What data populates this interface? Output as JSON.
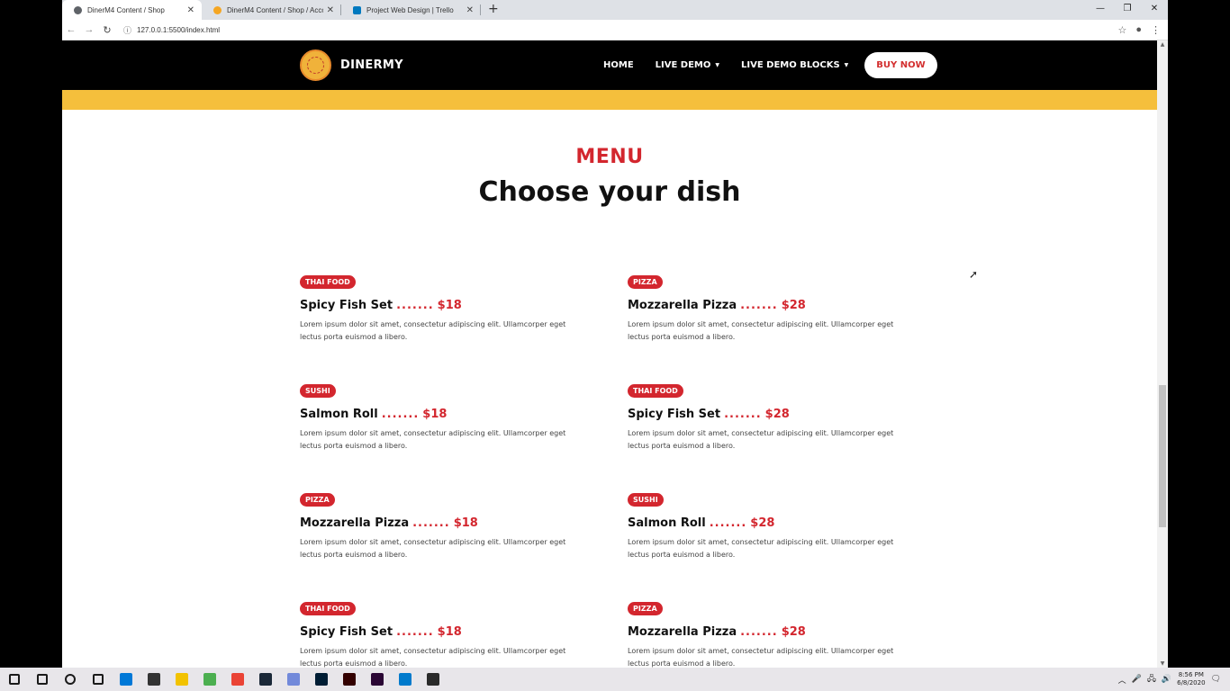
{
  "browser": {
    "tabs": [
      {
        "title": "DinerM4 Content / Shop",
        "active": true,
        "favicon_color": "#5f6368"
      },
      {
        "title": "DinerM4 Content / Shop / Accou",
        "active": false,
        "favicon_color": "#f5a623"
      },
      {
        "title": "Project Web Design | Trello",
        "active": false,
        "favicon_color": "#0079bf"
      }
    ],
    "new_tab": "+",
    "url": "127.0.0.1:5500/index.html"
  },
  "site": {
    "logo_text": "DINERMY",
    "nav": {
      "home": "HOME",
      "live_demo": "LIVE DEMO",
      "live_demo_blocks": "LIVE DEMO BLOCKS",
      "buy_now": "BUY NOW"
    },
    "menu_section": {
      "eyebrow": "MENU",
      "headline": "Choose your dish",
      "dots": ".......",
      "items": [
        {
          "tag": "THAI FOOD",
          "name": "Spicy Fish Set",
          "price": "$18",
          "desc": "Lorem ipsum dolor sit amet, consectetur adipiscing elit. Ullamcorper eget lectus porta euismod a libero."
        },
        {
          "tag": "PIZZA",
          "name": "Mozzarella Pizza",
          "price": "$28",
          "desc": "Lorem ipsum dolor sit amet, consectetur adipiscing elit. Ullamcorper eget lectus porta euismod a libero."
        },
        {
          "tag": "SUSHI",
          "name": "Salmon Roll",
          "price": "$18",
          "desc": "Lorem ipsum dolor sit amet, consectetur adipiscing elit. Ullamcorper eget lectus porta euismod a libero."
        },
        {
          "tag": "THAI FOOD",
          "name": "Spicy Fish Set",
          "price": "$28",
          "desc": "Lorem ipsum dolor sit amet, consectetur adipiscing elit. Ullamcorper eget lectus porta euismod a libero."
        },
        {
          "tag": "PIZZA",
          "name": "Mozzarella Pizza",
          "price": "$18",
          "desc": "Lorem ipsum dolor sit amet, consectetur adipiscing elit. Ullamcorper eget lectus porta euismod a libero."
        },
        {
          "tag": "SUSHI",
          "name": "Salmon Roll",
          "price": "$28",
          "desc": "Lorem ipsum dolor sit amet, consectetur adipiscing elit. Ullamcorper eget lectus porta euismod a libero."
        },
        {
          "tag": "THAI FOOD",
          "name": "Spicy Fish Set",
          "price": "$18",
          "desc": "Lorem ipsum dolor sit amet, consectetur adipiscing elit. Ullamcorper eget lectus porta euismod a libero."
        },
        {
          "tag": "PIZZA",
          "name": "Mozzarella Pizza",
          "price": "$28",
          "desc": "Lorem ipsum dolor sit amet, consectetur adipiscing elit. Ullamcorper eget lectus porta euismod a libero."
        }
      ]
    },
    "colors": {
      "accent": "#d3262e",
      "band": "#f5bf3c",
      "nav_bg": "#000000"
    }
  },
  "taskbar": {
    "time": "8:56 PM",
    "date": "6/8/2020",
    "apps": [
      {
        "name": "windows-start-icon",
        "color": "#1a1a1a"
      },
      {
        "name": "search-icon",
        "color": "#1a1a1a"
      },
      {
        "name": "cortana-icon",
        "color": "#1a1a1a"
      },
      {
        "name": "task-view-icon",
        "color": "#1a1a1a"
      },
      {
        "name": "edge-icon",
        "color": "#0078d7"
      },
      {
        "name": "store-icon",
        "color": "#333333"
      },
      {
        "name": "file-explorer-icon",
        "color": "#f2c200"
      },
      {
        "name": "utorrent-icon",
        "color": "#4caf50"
      },
      {
        "name": "chrome-icon",
        "color": "#ea4335"
      },
      {
        "name": "steam-icon",
        "color": "#1b2838"
      },
      {
        "name": "discord-icon",
        "color": "#7289da"
      },
      {
        "name": "photoshop-icon",
        "color": "#001d34"
      },
      {
        "name": "illustrator-icon",
        "color": "#330000"
      },
      {
        "name": "premiere-icon",
        "color": "#2a0634"
      },
      {
        "name": "vscode-icon",
        "color": "#007acc"
      },
      {
        "name": "epic-games-icon",
        "color": "#2a2a2a"
      }
    ]
  }
}
